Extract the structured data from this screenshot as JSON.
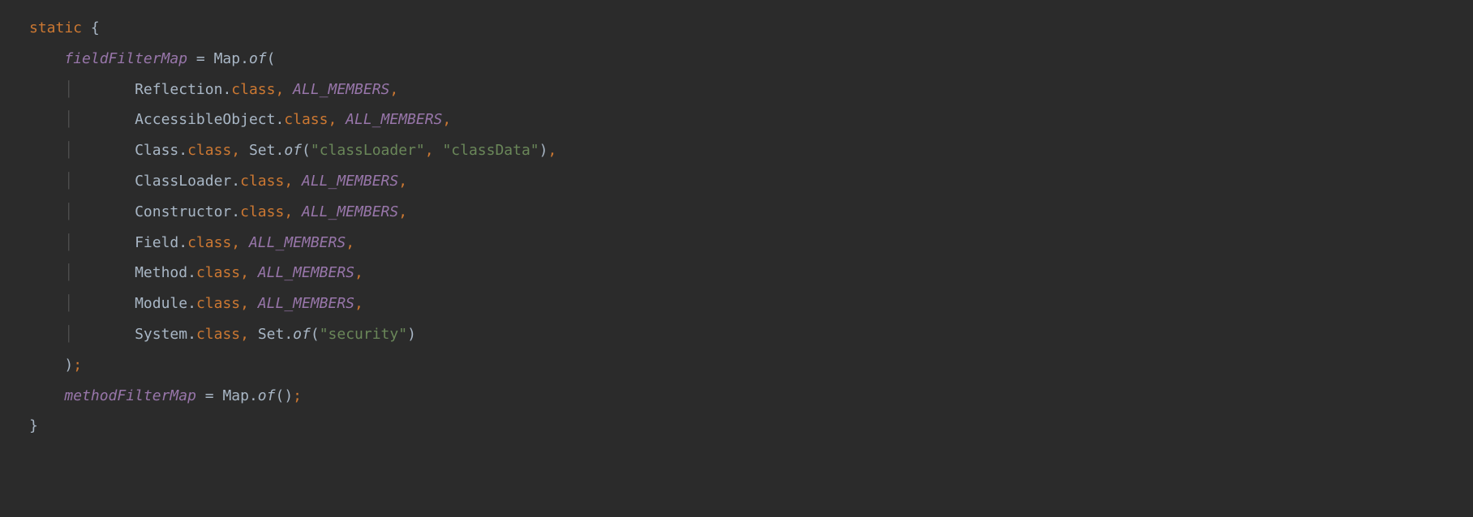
{
  "code": {
    "l0": {
      "static": "static",
      "open": " {"
    },
    "l1": {
      "indent": "    ",
      "field": "fieldFilterMap",
      "eq": " = ",
      "map": "Map",
      "dot": ".",
      "of": "of",
      "open": "("
    },
    "l2": {
      "indent": "    ",
      "guide": "│",
      "sp": "       ",
      "cls": "Reflection",
      "dot": ".",
      "kw": "class",
      "comma": ", ",
      "val": "ALL_MEMBERS",
      "end": ","
    },
    "l3": {
      "indent": "    ",
      "guide": "│",
      "sp": "       ",
      "cls": "AccessibleObject",
      "dot": ".",
      "kw": "class",
      "comma": ", ",
      "val": "ALL_MEMBERS",
      "end": ","
    },
    "l4": {
      "indent": "    ",
      "guide": "│",
      "sp": "       ",
      "cls": "Class",
      "dot": ".",
      "kw": "class",
      "comma": ", ",
      "set": "Set",
      "dot2": ".",
      "of": "of",
      "open": "(",
      "s1": "\"classLoader\"",
      "c1": ", ",
      "s2": "\"classData\"",
      "close": ")",
      "end": ","
    },
    "l5": {
      "indent": "    ",
      "guide": "│",
      "sp": "       ",
      "cls": "ClassLoader",
      "dot": ".",
      "kw": "class",
      "comma": ", ",
      "val": "ALL_MEMBERS",
      "end": ","
    },
    "l6": {
      "indent": "    ",
      "guide": "│",
      "sp": "       ",
      "cls": "Constructor",
      "dot": ".",
      "kw": "class",
      "comma": ", ",
      "val": "ALL_MEMBERS",
      "end": ","
    },
    "l7": {
      "indent": "    ",
      "guide": "│",
      "sp": "       ",
      "cls": "Field",
      "dot": ".",
      "kw": "class",
      "comma": ", ",
      "val": "ALL_MEMBERS",
      "end": ","
    },
    "l8": {
      "indent": "    ",
      "guide": "│",
      "sp": "       ",
      "cls": "Method",
      "dot": ".",
      "kw": "class",
      "comma": ", ",
      "val": "ALL_MEMBERS",
      "end": ","
    },
    "l9": {
      "indent": "    ",
      "guide": "│",
      "sp": "       ",
      "cls": "Module",
      "dot": ".",
      "kw": "class",
      "comma": ", ",
      "val": "ALL_MEMBERS",
      "end": ","
    },
    "l10": {
      "indent": "    ",
      "guide": "│",
      "sp": "       ",
      "cls": "System",
      "dot": ".",
      "kw": "class",
      "comma": ", ",
      "set": "Set",
      "dot2": ".",
      "of": "of",
      "open": "(",
      "s1": "\"security\"",
      "close": ")"
    },
    "l11": {
      "indent": "    ",
      "close": ")",
      "semi": ";"
    },
    "l12": {
      "indent": "    ",
      "field": "methodFilterMap",
      "eq": " = ",
      "map": "Map",
      "dot": ".",
      "of": "of",
      "open": "()",
      "semi": ";"
    },
    "l13": {
      "close": "}"
    }
  }
}
